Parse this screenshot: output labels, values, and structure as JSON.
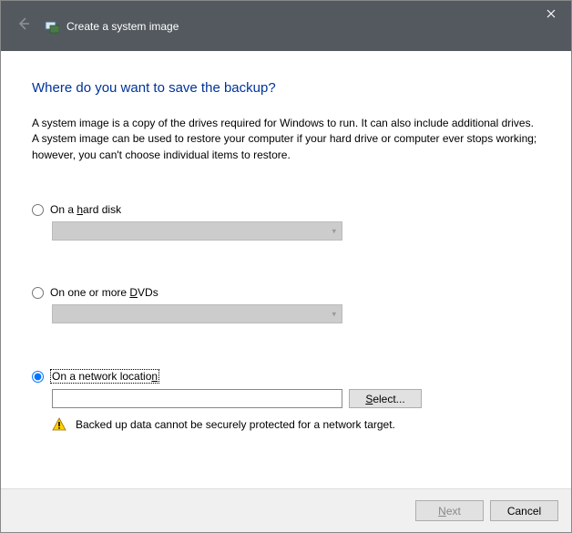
{
  "window": {
    "title": "Create a system image"
  },
  "heading": "Where do you want to save the backup?",
  "description": "A system image is a copy of the drives required for Windows to run. It can also include additional drives. A system image can be used to restore your computer if your hard drive or computer ever stops working; however, you can't choose individual items to restore.",
  "options": {
    "hard_disk": {
      "label_pre": "On a ",
      "label_ul": "h",
      "label_post": "ard disk",
      "selected": false
    },
    "dvds": {
      "label_pre": "On one or more ",
      "label_ul": "D",
      "label_post": "VDs",
      "selected": false
    },
    "network": {
      "label_pre": "On a network locatio",
      "label_ul": "n",
      "label_post": "",
      "selected": true
    }
  },
  "network": {
    "path": "",
    "select_pre": "",
    "select_ul": "S",
    "select_post": "elect...",
    "warning": "Backed up data cannot be securely protected for a network target."
  },
  "footer": {
    "next_ul": "N",
    "next_post": "ext",
    "cancel": "Cancel"
  }
}
